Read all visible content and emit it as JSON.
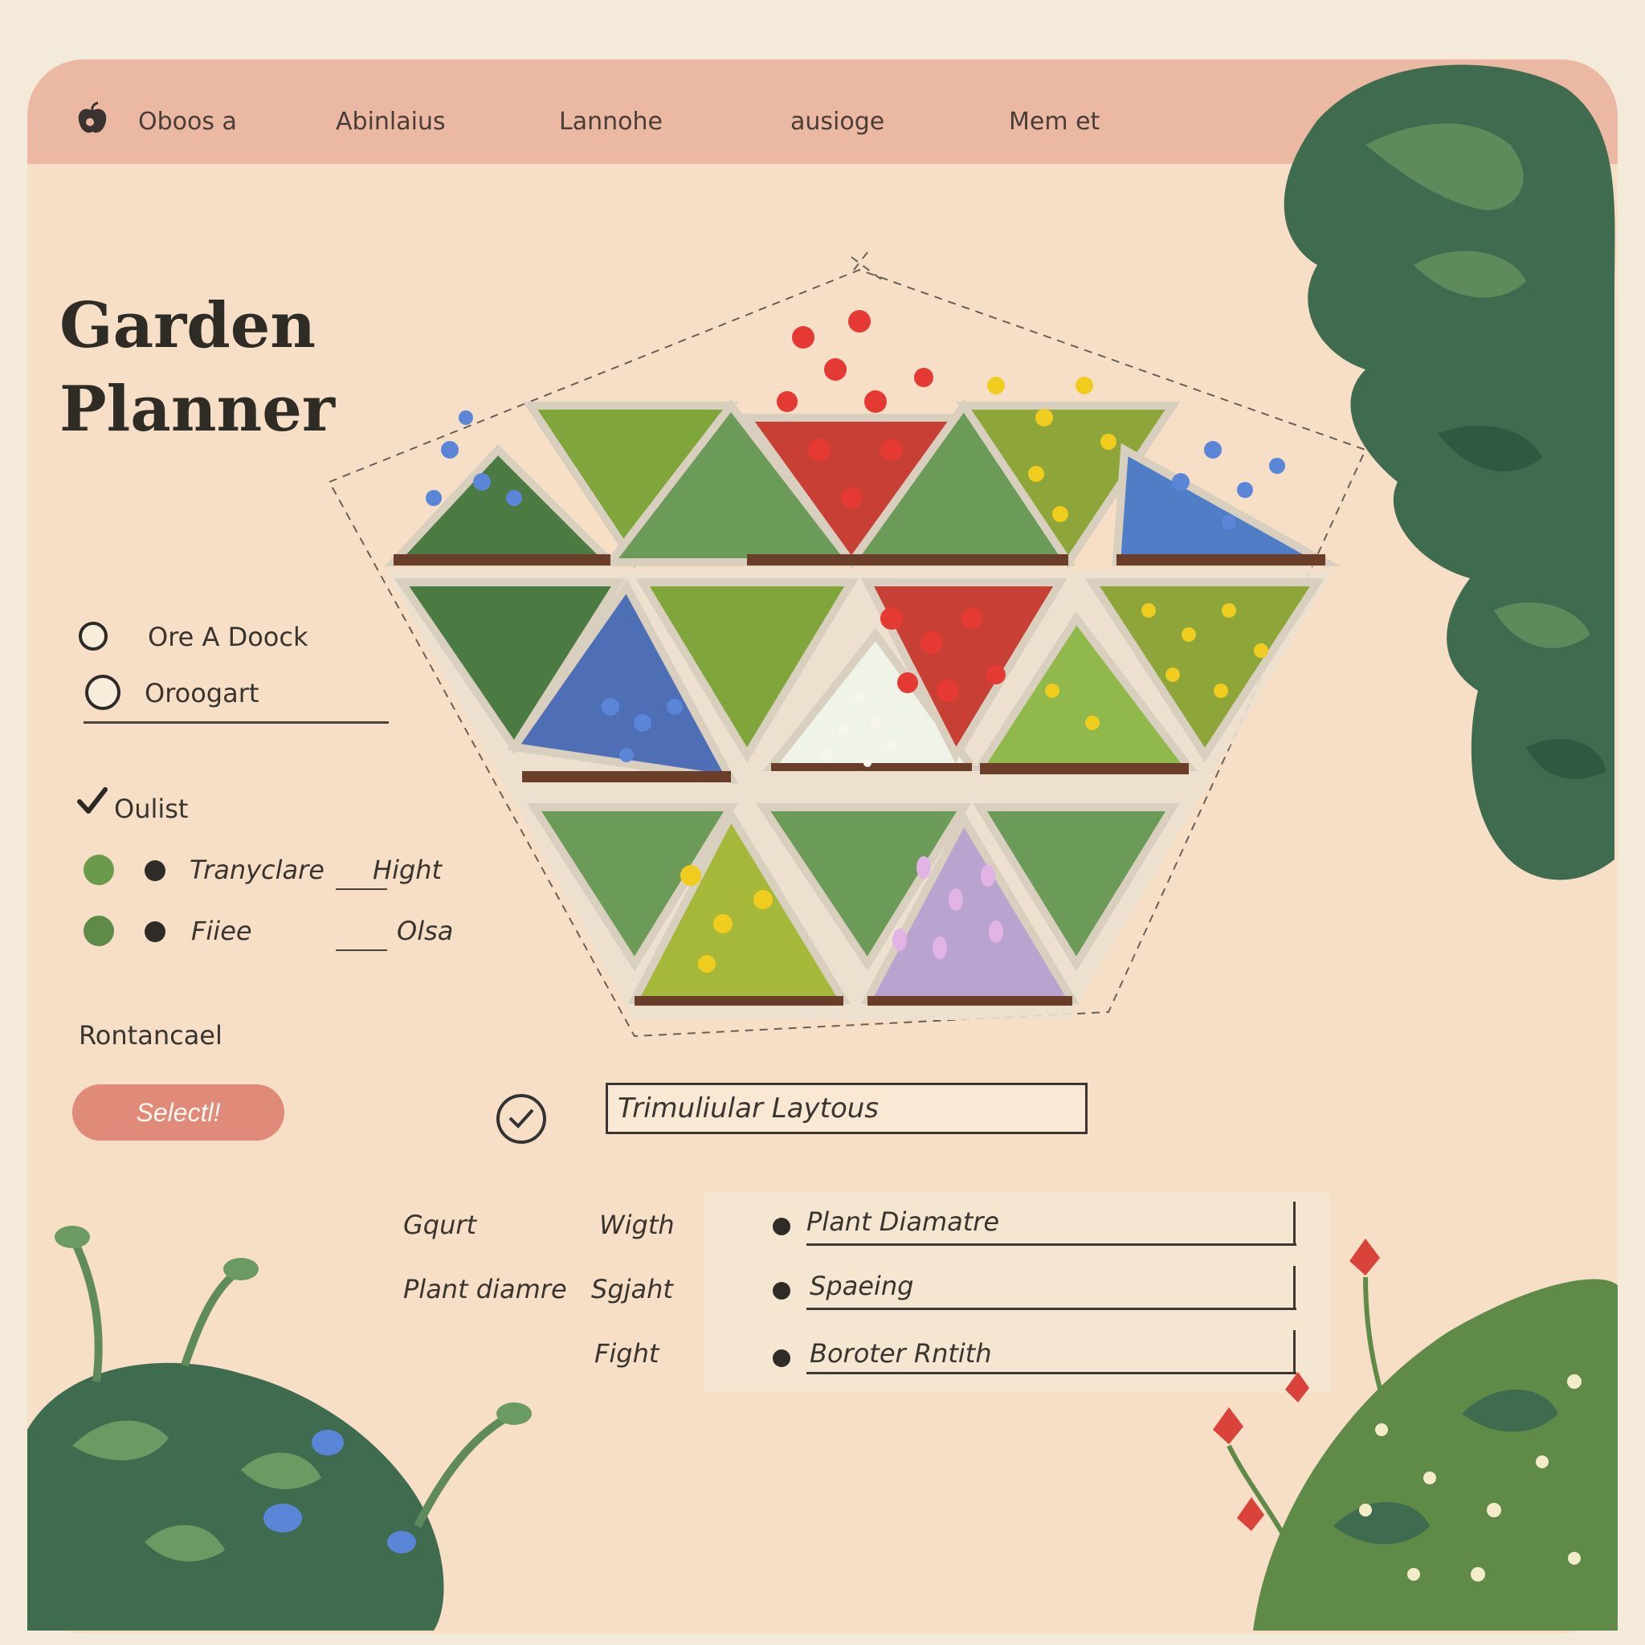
{
  "nav": {
    "brand": "Oboos a",
    "items": [
      "Abinlaius",
      "Lannohe",
      "ausioge",
      "Mem et"
    ]
  },
  "title": {
    "line1": "Garden",
    "line2": "Planner"
  },
  "options": {
    "radio1": "Ore A Doock",
    "radio2": "Oroogart",
    "check_label": "Oulist",
    "row1": {
      "left": "Tranyclare",
      "right": "Hight"
    },
    "row2": {
      "left": "Fiiee",
      "right": "Olsa"
    },
    "section_label": "Rontancael"
  },
  "select_button": "Selectl!",
  "layout_field": "Trimuliular Laytous",
  "params": {
    "left_col": [
      "Gqurt",
      "Plant diamre",
      ""
    ],
    "right_col": [
      "Wigth",
      "Sgjaht",
      "Fight"
    ],
    "fields": [
      "Plant Diamatre",
      "Spaeing",
      "Boroter Rntith"
    ]
  },
  "colors": {
    "nav_bg": "#eab8a3",
    "card_bg": "#f6dfc6",
    "accent_button": "#e08a7a",
    "plant_green": "#5f8a48",
    "foliage_dark": "#3f6b4f",
    "flower_red": "#d9433a",
    "flower_yellow": "#f0cc1f",
    "flower_blue": "#5b86d8",
    "flower_white": "#f4f1e6",
    "flower_pink": "#d9a8dc"
  },
  "icons": [
    "apple-logo-icon",
    "radio-icon",
    "checkmark-icon",
    "check-circle-icon",
    "bullet-dot-icon"
  ]
}
